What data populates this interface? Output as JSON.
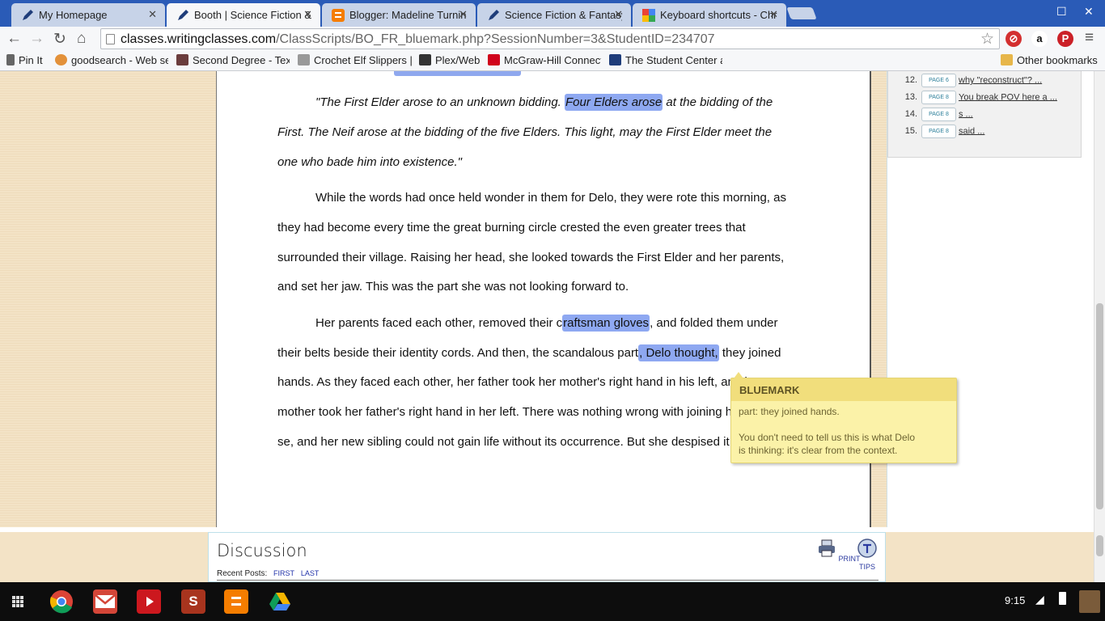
{
  "tabs": [
    {
      "title": "My Homepage",
      "icon": "pen-icon",
      "active": false
    },
    {
      "title": "Booth | Science Fiction & Fantasy",
      "icon": "pen-icon",
      "active": true
    },
    {
      "title": "Blogger: Madeline Turning",
      "icon": "blogger-icon",
      "active": false
    },
    {
      "title": "Science Fiction & Fantasy",
      "icon": "pen-icon",
      "active": false
    },
    {
      "title": "Keyboard shortcuts - Chrome",
      "icon": "google-icon",
      "active": false
    }
  ],
  "toolbar": {
    "url_host": "classes.writingclasses.com",
    "url_path": "/ClassScripts/BO_FR_bluemark.php?SessionNumber=3&StudentID=234707"
  },
  "bookmarks": [
    {
      "label": "Pin It",
      "icon": "pin-icon"
    },
    {
      "label": "goodsearch - Web se",
      "icon": "goodsearch-icon"
    },
    {
      "label": "Second Degree - Tex",
      "icon": "castle-icon"
    },
    {
      "label": "Crochet Elf Slippers |",
      "icon": "crochet-icon"
    },
    {
      "label": "Plex/Web",
      "icon": "plex-icon"
    },
    {
      "label": "McGraw-Hill Connect",
      "icon": "mcgraw-icon"
    },
    {
      "label": "The Student Center a",
      "icon": "pen-icon"
    }
  ],
  "other_bookmarks": "Other bookmarks",
  "comments": [
    {
      "num": "12.",
      "page": "PAGE 6",
      "text": "why \"reconstruct\"? ..."
    },
    {
      "num": "13.",
      "page": "PAGE 8",
      "text": "You break POV here a ..."
    },
    {
      "num": "14.",
      "page": "PAGE 8",
      "text": "s ..."
    },
    {
      "num": "15.",
      "page": "PAGE 8",
      "text": "said ..."
    }
  ],
  "document": {
    "p1": {
      "l1a": "\"The First Elder arose to an unknown bidding. ",
      "l1h": "Four Elders arose",
      "l1b": " at the bidding of the",
      "l2": "First. The Neif arose at the bidding of the five Elders. This light, may the First Elder meet the",
      "l3": "one who bade him into existence.\""
    },
    "p2": {
      "l1": "While the words had once held wonder in them for Delo, they were rote this morning, as",
      "l2": "they had become every time the great burning circle crested the even greater trees that",
      "l3": "surrounded their village. Raising her head, she looked towards the First Elder and her parents,",
      "l4": "and set her jaw. This was the part she was not looking forward to."
    },
    "p3": {
      "l1a": "Her parents faced each other, removed their c",
      "l1h": "raftsman gloves",
      "l1b": ", and folded them under",
      "l2a": "their belts beside their identity cords. And then, the scandalous part",
      "l2h": ", Delo thought,",
      "l2b": " they joined",
      "l3": "hands. As they faced each other, her father took her mother's right hand in his left, and her",
      "l4": "mother took her father's right hand in her left. There was nothing wrong with joining hands, per",
      "l5": "se, and her new sibling could not gain life without its occurrence. But she despised it."
    }
  },
  "bluemark": {
    "header": "BLUEMARK",
    "quote": "part: they joined hands.",
    "comment_l1": "You don't need to tell us this is what Delo",
    "comment_l2": "is thinking: it's clear from the context."
  },
  "discussion": {
    "title": "Discussion",
    "recent_label": "Recent Posts:",
    "first": "FIRST",
    "last": "LAST",
    "print": "PRINT",
    "tips": "TIPS"
  },
  "shelf": {
    "clock": "9:15",
    "apps": [
      "apps-launcher-icon",
      "chrome-icon",
      "gmail-icon",
      "youtube-icon",
      "s-app-icon",
      "blogger-icon",
      "drive-icon"
    ]
  },
  "colors": {
    "highlight": "#8ea8f1",
    "tooltip": "#fbf2a8",
    "tabstrip": "#2a5bb7"
  }
}
